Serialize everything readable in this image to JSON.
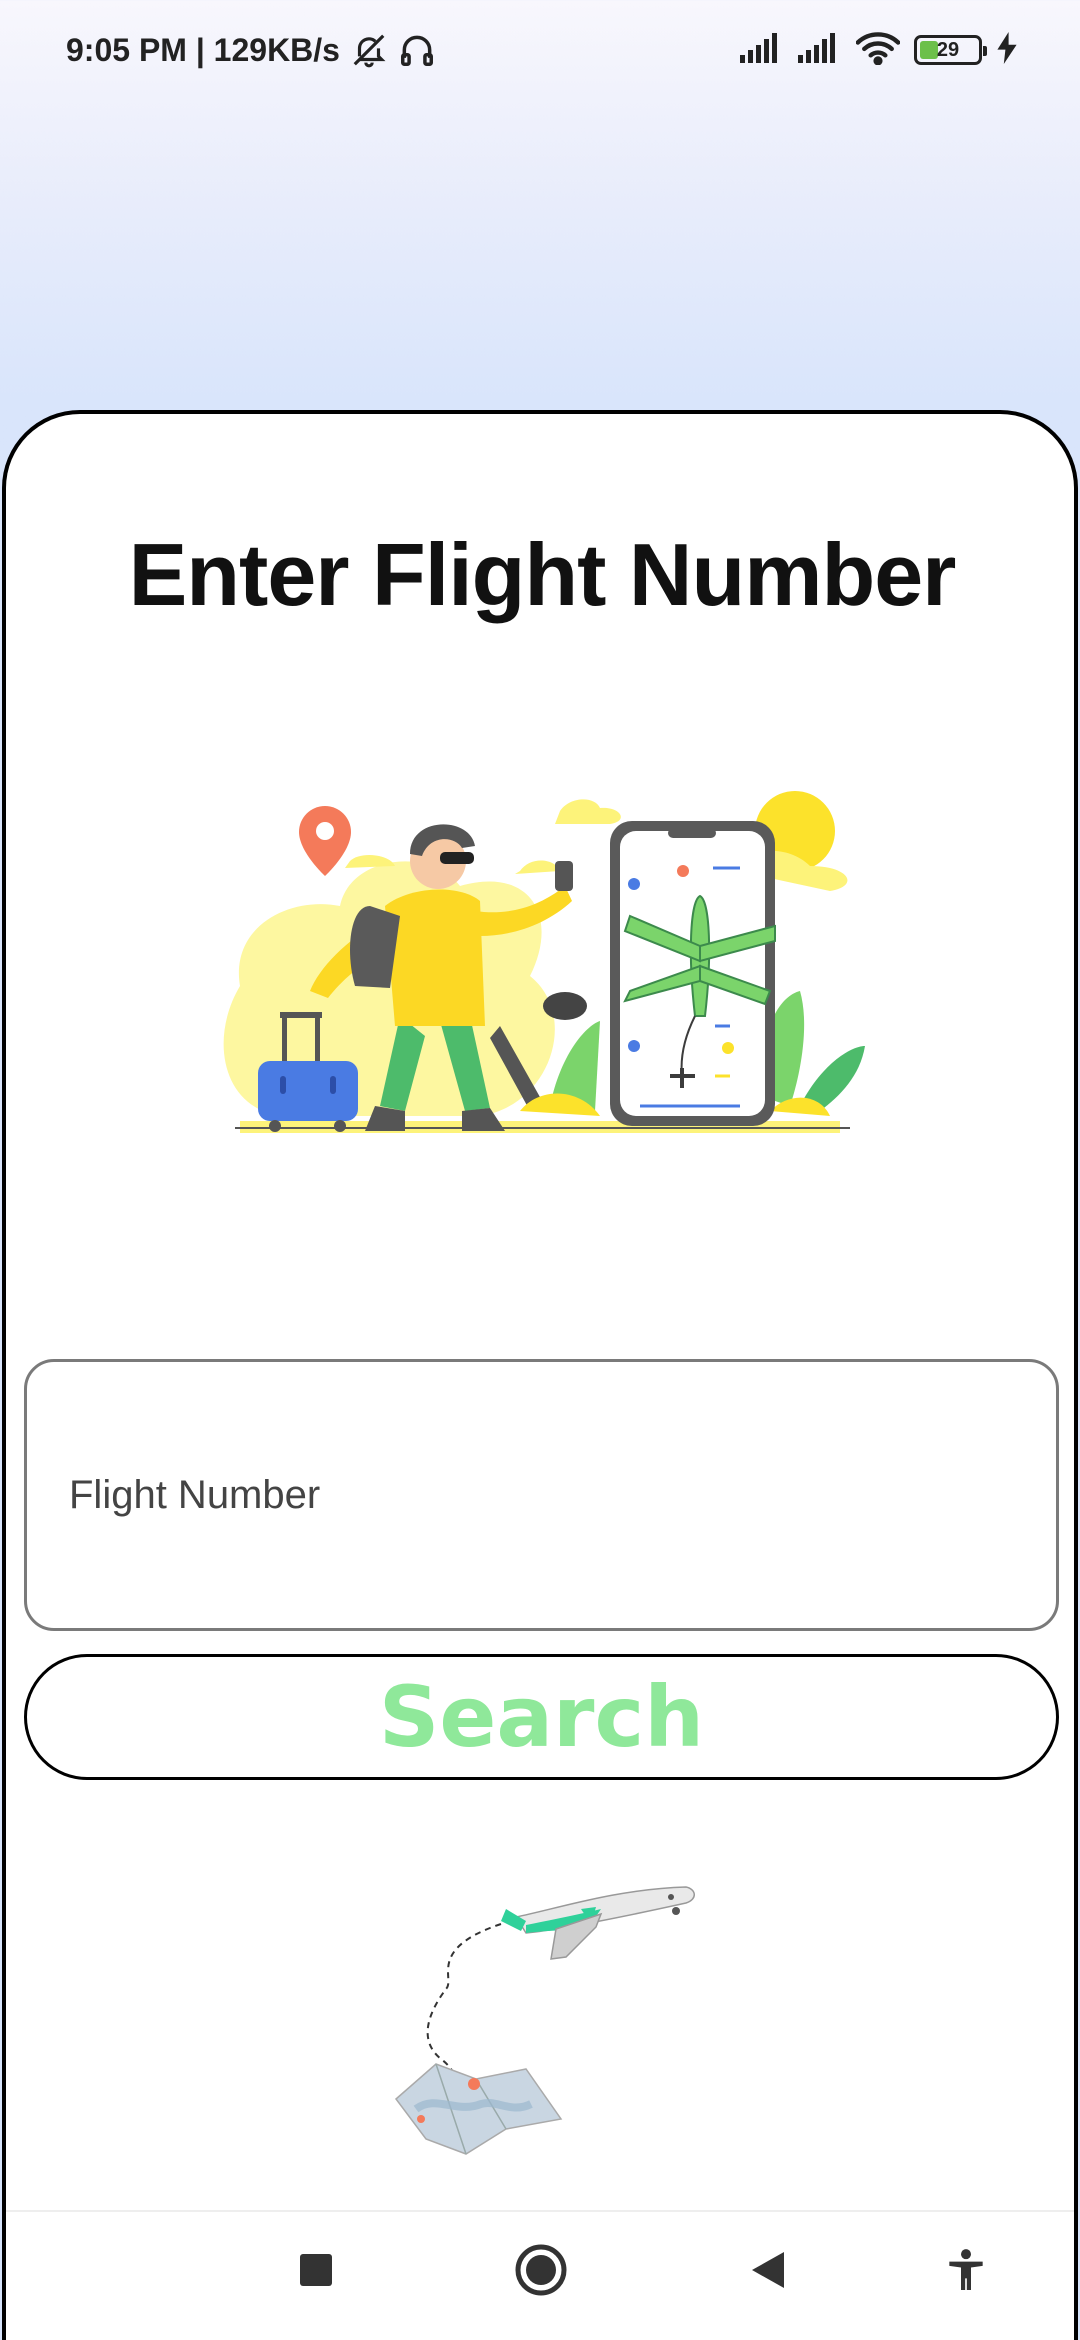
{
  "status_bar": {
    "time_speed": "9:05 PM | 129KB/s",
    "battery_level": "29"
  },
  "page": {
    "title": "Enter Flight Number"
  },
  "form": {
    "flight_number_placeholder": "Flight Number",
    "flight_number_value": "",
    "search_label": "Search"
  },
  "colors": {
    "accent_green": "#8fe89a",
    "background_gradient_end": "#d6e3fb"
  },
  "icons": {
    "status": [
      "bell-off-icon",
      "headphones-icon",
      "signal-icon",
      "signal-icon",
      "wifi-icon",
      "battery-icon",
      "charging-icon"
    ],
    "nav": [
      "recent-apps-icon",
      "home-icon",
      "back-icon",
      "accessibility-icon"
    ]
  }
}
